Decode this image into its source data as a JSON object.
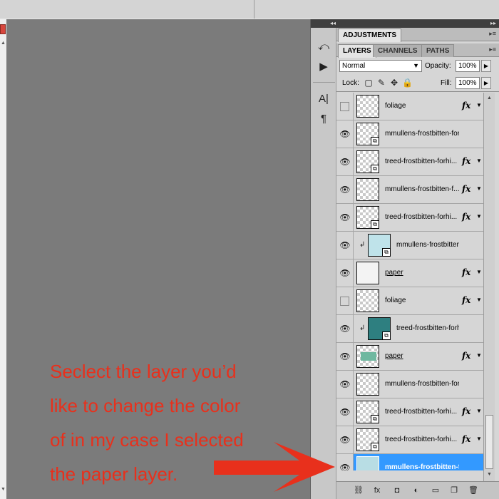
{
  "dock": {
    "collapse_glyph": "◂◂",
    "icons": [
      {
        "name": "history-icon",
        "glyph": "⤺"
      },
      {
        "name": "actions-play-icon",
        "glyph": "▶"
      },
      {
        "name": "character-icon",
        "glyph": "A|"
      },
      {
        "name": "paragraph-icon",
        "glyph": "¶"
      }
    ]
  },
  "panel": {
    "collapse_glyph": "▸▸",
    "adjustments_tab": "ADJUSTMENTS",
    "tabs": [
      "LAYERS",
      "CHANNELS",
      "PATHS"
    ],
    "blend_mode": "Normal",
    "opacity_label": "Opacity:",
    "opacity_value": "100%",
    "lock_label": "Lock:",
    "fill_label": "Fill:",
    "fill_value": "100%"
  },
  "layers": [
    {
      "name": "foliage",
      "visible": false,
      "fx": true,
      "smart": false,
      "clipped": false,
      "underline": false,
      "selected": false
    },
    {
      "name": "mmullens-frostbitten-forhi...",
      "visible": true,
      "fx": false,
      "smart": true,
      "clipped": false,
      "underline": false,
      "selected": false
    },
    {
      "name": "treed-frostbitten-forhi...",
      "visible": true,
      "fx": true,
      "smart": true,
      "clipped": false,
      "underline": false,
      "selected": false
    },
    {
      "name": "mmullens-frostbitten-f...",
      "visible": true,
      "fx": true,
      "smart": false,
      "clipped": false,
      "underline": false,
      "selected": false
    },
    {
      "name": "treed-frostbitten-forhi...",
      "visible": true,
      "fx": true,
      "smart": true,
      "clipped": false,
      "underline": false,
      "selected": false
    },
    {
      "name": "mmullens-frostbitten-f...",
      "visible": true,
      "fx": false,
      "smart": true,
      "clipped": true,
      "underline": false,
      "selected": false,
      "thumb": "light-blue"
    },
    {
      "name": "paper",
      "visible": true,
      "fx": true,
      "smart": false,
      "clipped": false,
      "underline": true,
      "selected": false,
      "thumb": "white"
    },
    {
      "name": "foliage",
      "visible": false,
      "fx": true,
      "smart": false,
      "clipped": false,
      "underline": false,
      "selected": false
    },
    {
      "name": "treed-frostbitten-forhi...",
      "visible": true,
      "fx": false,
      "smart": true,
      "clipped": true,
      "underline": false,
      "selected": false,
      "thumb": "teal"
    },
    {
      "name": "paper",
      "visible": true,
      "fx": true,
      "smart": false,
      "clipped": false,
      "underline": true,
      "selected": false,
      "thumb": "green-patch"
    },
    {
      "name": "mmullens-frostbitten-forhi...",
      "visible": true,
      "fx": false,
      "smart": false,
      "clipped": false,
      "underline": false,
      "selected": false
    },
    {
      "name": "treed-frostbitten-forhi...",
      "visible": true,
      "fx": true,
      "smart": true,
      "clipped": false,
      "underline": false,
      "selected": false
    },
    {
      "name": "treed-frostbitten-forhi...",
      "visible": true,
      "fx": true,
      "smart": true,
      "clipped": false,
      "underline": false,
      "selected": false
    },
    {
      "name": "mmullens-frostbitten-f...",
      "visible": true,
      "fx": false,
      "smart": false,
      "clipped": false,
      "underline": false,
      "selected": true,
      "thumb": "pale-blue"
    }
  ],
  "bottom_icons": [
    {
      "name": "link-layers-icon",
      "glyph": "⛓"
    },
    {
      "name": "fx-icon",
      "glyph": "fx"
    },
    {
      "name": "mask-icon",
      "glyph": "◘"
    },
    {
      "name": "adjustment-layer-icon",
      "glyph": "◐"
    },
    {
      "name": "new-group-icon",
      "glyph": "▭"
    },
    {
      "name": "new-layer-icon",
      "glyph": "❐"
    },
    {
      "name": "trash-icon",
      "glyph": "🗑"
    }
  ],
  "annotation": {
    "lines": [
      "Seclect the layer you’d",
      "like to change the color",
      "of in my case I selected",
      "the paper layer."
    ],
    "color": "#e8301c"
  },
  "colors": {
    "selection": "#3399ff",
    "annotation": "#e8301c"
  }
}
